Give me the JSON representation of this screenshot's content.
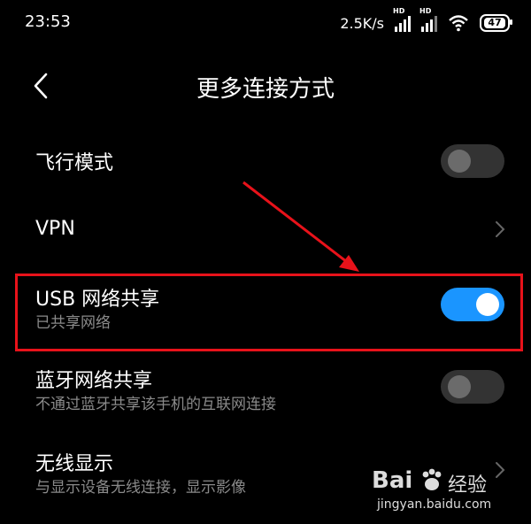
{
  "status": {
    "time": "23:53",
    "net_speed": "2.5K/s",
    "hd_label": "HD",
    "battery": "47"
  },
  "header": {
    "title": "更多连接方式"
  },
  "settings": [
    {
      "title": "飞行模式",
      "subtitle": "",
      "control": "toggle",
      "on": false
    },
    {
      "title": "VPN",
      "subtitle": "",
      "control": "chevron"
    },
    {
      "title": "USB 网络共享",
      "subtitle": "已共享网络",
      "control": "toggle",
      "on": true
    },
    {
      "title": "蓝牙网络共享",
      "subtitle": "不通过蓝牙共享该手机的互联网连接",
      "control": "toggle",
      "on": false
    },
    {
      "title": "无线显示",
      "subtitle": "与显示设备无线连接，显示影像",
      "control": "chevron"
    }
  ],
  "colors": {
    "toggle_on": "#1a95ff",
    "annotation": "#e8121a"
  },
  "watermark": {
    "logo": "Bai",
    "text": "经验",
    "url": "jingyan.baidu.com"
  }
}
